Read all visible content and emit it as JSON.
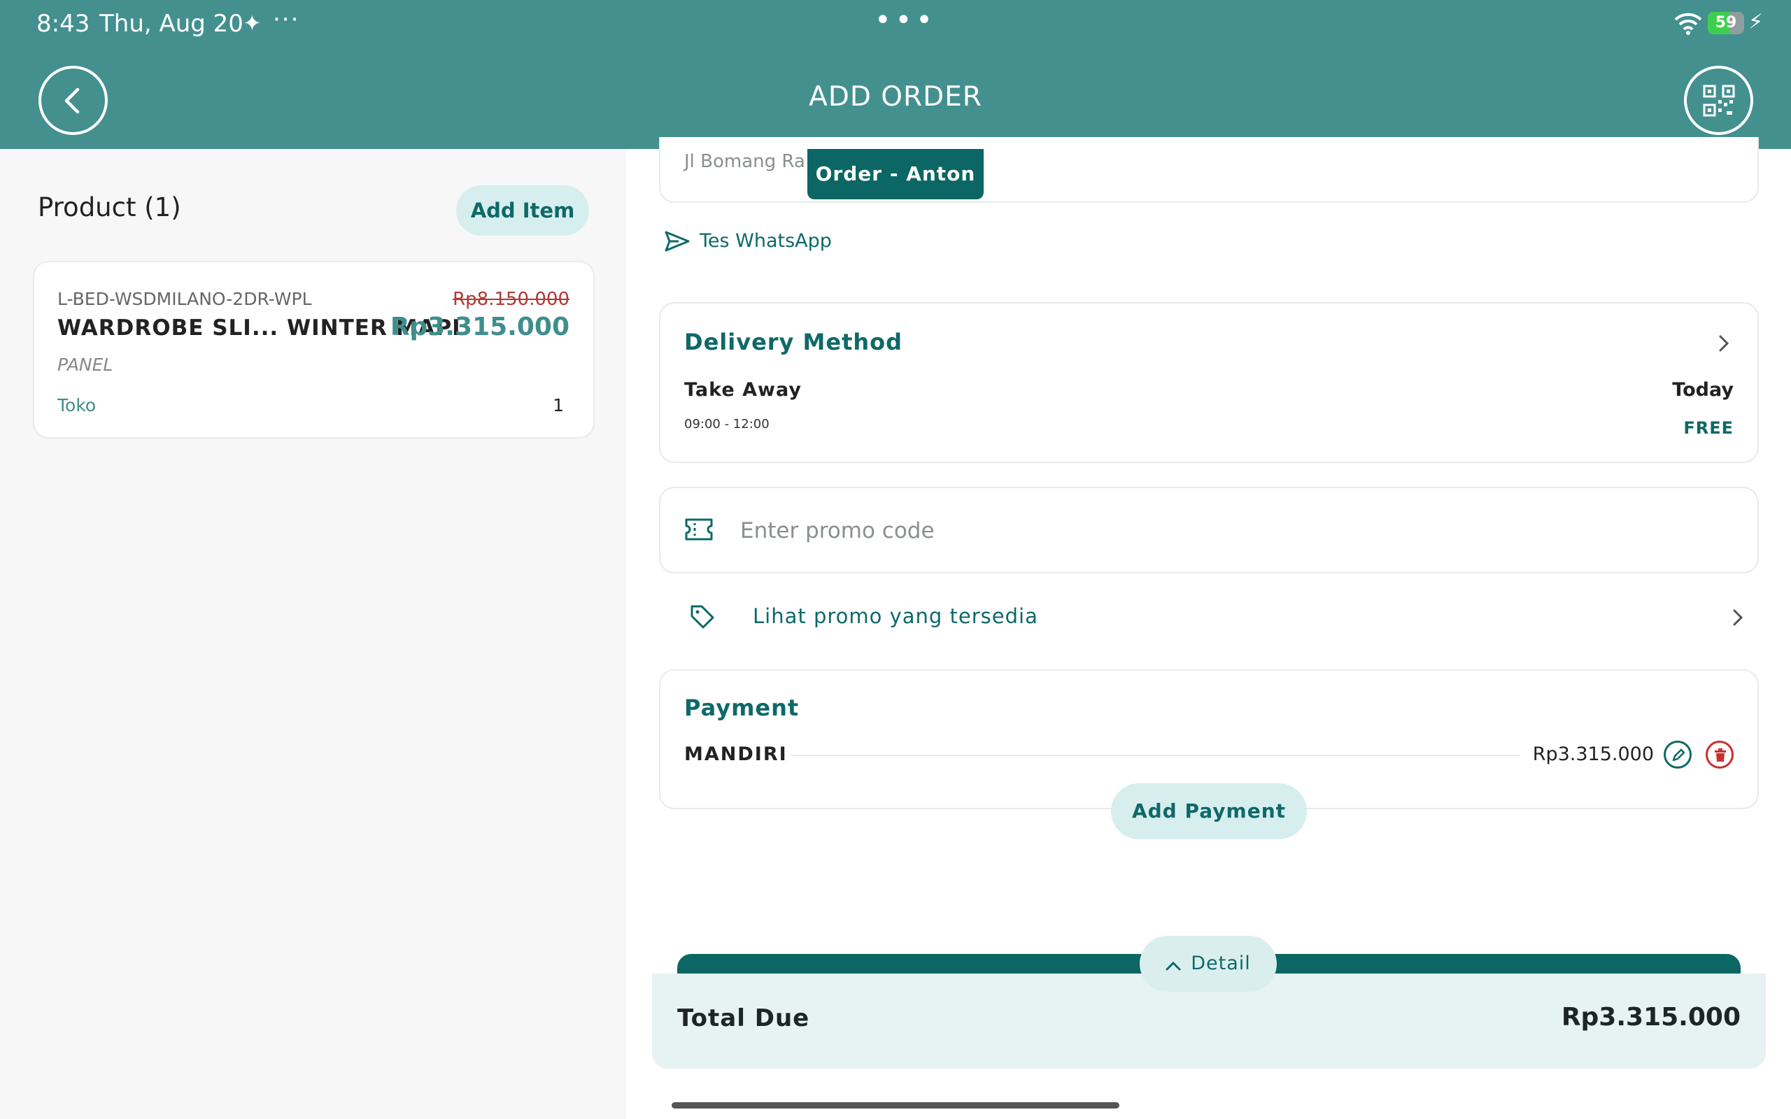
{
  "status_bar": {
    "time": "8:43",
    "date": "Thu, Aug 20",
    "spark": "✦",
    "more": "···",
    "center_dots": "•••",
    "battery": "59",
    "battery_level_percent": 59,
    "charge": "⚡"
  },
  "header": {
    "title": "ADD ORDER",
    "back_icon": "chevron-left-icon",
    "scan_icon": "qr-code-icon"
  },
  "products": {
    "heading": "Product (1)",
    "add_item_label": "Add Item",
    "items": [
      {
        "sku": "L-BED-WSDMILANO-2DR-WPL",
        "name": "WARDROBE SLI... WINTER MAPL",
        "old_price": "Rp8.150.000",
        "price": "Rp3.315.000",
        "variant": "PANEL",
        "store": "Toko",
        "quantity": "1"
      }
    ]
  },
  "address": {
    "text": "Jl Bomang Ra",
    "order_chip": "Order - Anton"
  },
  "whatsapp": {
    "label": "Tes WhatsApp",
    "icon": "send-icon"
  },
  "delivery": {
    "title": "Delivery Method",
    "type": "Take Away",
    "day": "Today",
    "time": "09:00 - 12:00",
    "fee": "FREE"
  },
  "promo": {
    "placeholder": "Enter promo code",
    "value": "",
    "icon": "ticket-icon",
    "link_label": "Lihat promo yang tersedia",
    "link_icon": "tag-icon"
  },
  "payment": {
    "title": "Payment",
    "method": "MANDIRI",
    "amount": "Rp3.315.000",
    "add_label": "Add Payment"
  },
  "summary": {
    "detail_label": "Detail",
    "total_label": "Total Due",
    "total_value": "Rp3.315.000"
  },
  "colors": {
    "header": "#43908f",
    "accent": "#0e6968",
    "chip": "#0b6664",
    "pill": "#d6eeee",
    "strike": "#b03a37",
    "delete": "#c9302c"
  }
}
